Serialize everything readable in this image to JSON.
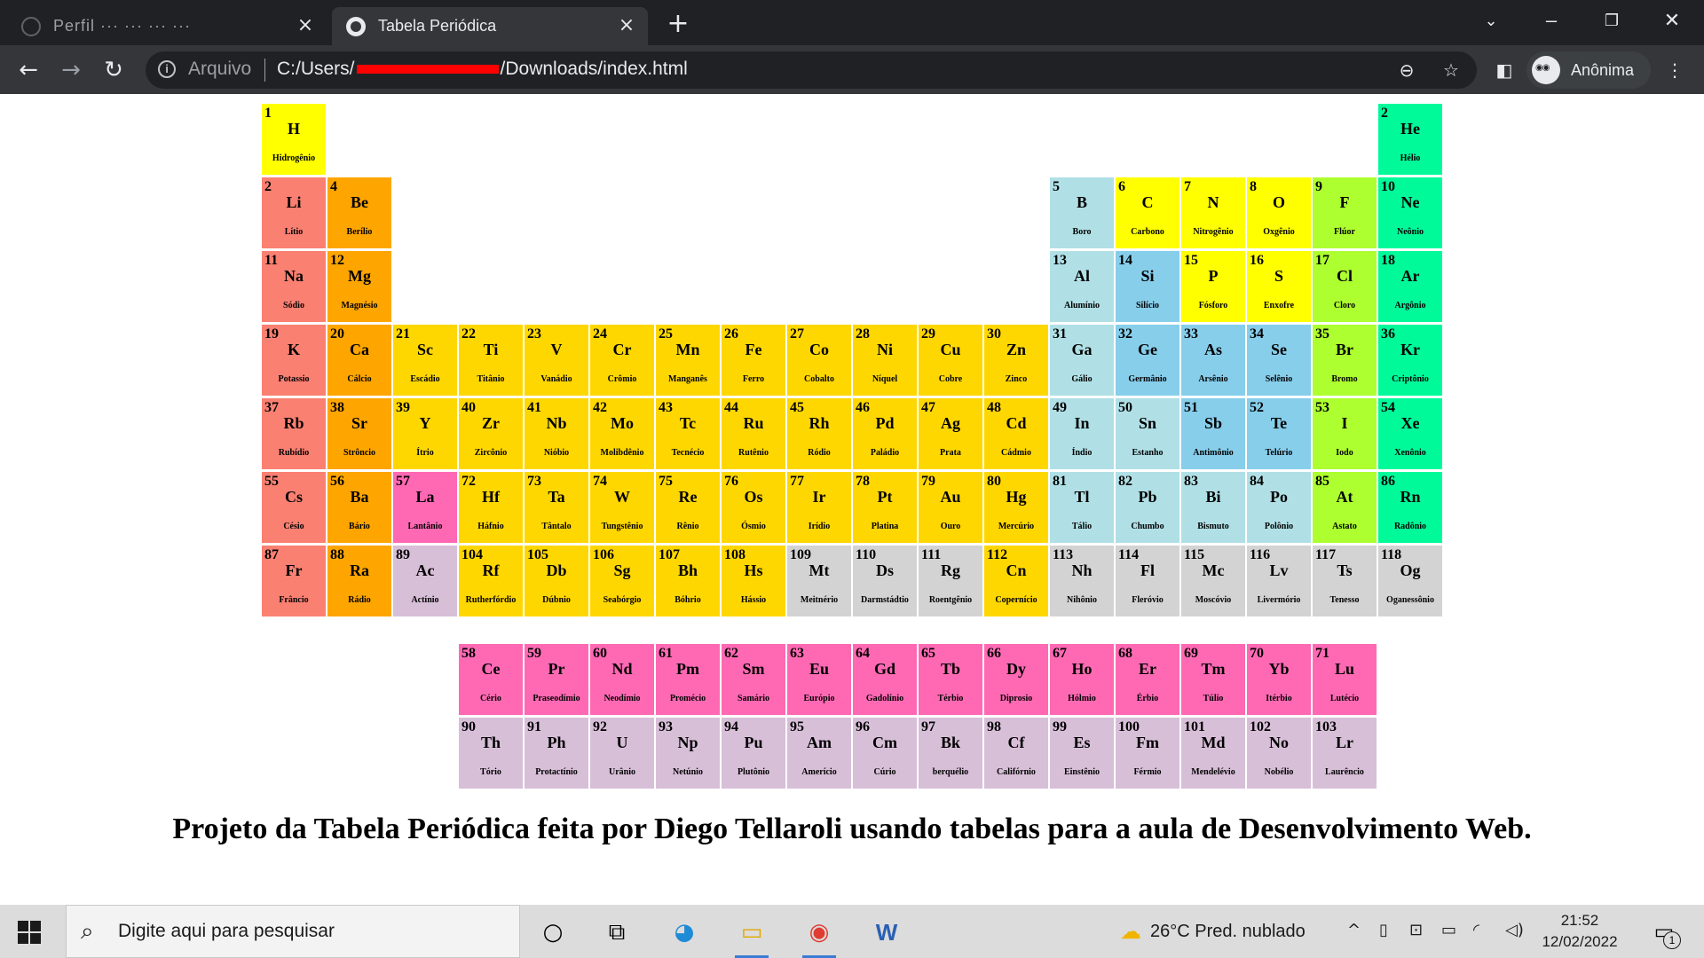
{
  "browser": {
    "inactive_tab_title": "Perfil ··· ··· ··· ···",
    "active_tab_title": "Tabela Periódica",
    "scheme_label": "Arquivo",
    "url_prefix": "C:/Users/",
    "url_suffix": "/Downloads/index.html",
    "profile_name": "Anônima"
  },
  "page": {
    "caption": "Projeto da Tabela Periódica feita por Diego Tellaroli usando tabelas para a aula de Desenvolvimento Web."
  },
  "colors": {
    "hydrogen": "#ffff00",
    "alkali": "#fa8072",
    "alkaline_earth": "#ffa500",
    "transition": "#ffd700",
    "post_transition": "#b0e0e6",
    "metalloid": "#87ceeb",
    "nonmetal": "#ffff00",
    "halogen": "#adff2f",
    "noble_gas": "#00fa9a",
    "lanthanide": "#ff69b4",
    "actinide": "#d8bfd8",
    "unknown": "#d3d3d3"
  },
  "elements": [
    {
      "n": "1",
      "s": "H",
      "name": "Hidrogênio",
      "row": 1,
      "col": 1,
      "cat": "hydrogen"
    },
    {
      "n": "2",
      "s": "He",
      "name": "Hélio",
      "row": 1,
      "col": 18,
      "cat": "noble_gas"
    },
    {
      "n": "2",
      "s": "Li",
      "name": "Lítio",
      "row": 2,
      "col": 1,
      "cat": "alkali"
    },
    {
      "n": "4",
      "s": "Be",
      "name": "Berílio",
      "row": 2,
      "col": 2,
      "cat": "alkaline_earth"
    },
    {
      "n": "5",
      "s": "B",
      "name": "Boro",
      "row": 2,
      "col": 13,
      "cat": "post_transition"
    },
    {
      "n": "6",
      "s": "C",
      "name": "Carbono",
      "row": 2,
      "col": 14,
      "cat": "nonmetal"
    },
    {
      "n": "7",
      "s": "N",
      "name": "Nitrogênio",
      "row": 2,
      "col": 15,
      "cat": "nonmetal"
    },
    {
      "n": "8",
      "s": "O",
      "name": "Oxgênio",
      "row": 2,
      "col": 16,
      "cat": "nonmetal"
    },
    {
      "n": "9",
      "s": "F",
      "name": "Flúor",
      "row": 2,
      "col": 17,
      "cat": "halogen"
    },
    {
      "n": "10",
      "s": "Ne",
      "name": "Neônio",
      "row": 2,
      "col": 18,
      "cat": "noble_gas"
    },
    {
      "n": "11",
      "s": "Na",
      "name": "Sódio",
      "row": 3,
      "col": 1,
      "cat": "alkali"
    },
    {
      "n": "12",
      "s": "Mg",
      "name": "Magnésio",
      "row": 3,
      "col": 2,
      "cat": "alkaline_earth"
    },
    {
      "n": "13",
      "s": "Al",
      "name": "Alumínio",
      "row": 3,
      "col": 13,
      "cat": "post_transition"
    },
    {
      "n": "14",
      "s": "Si",
      "name": "Silício",
      "row": 3,
      "col": 14,
      "cat": "metalloid"
    },
    {
      "n": "15",
      "s": "P",
      "name": "Fósforo",
      "row": 3,
      "col": 15,
      "cat": "nonmetal"
    },
    {
      "n": "16",
      "s": "S",
      "name": "Enxofre",
      "row": 3,
      "col": 16,
      "cat": "nonmetal"
    },
    {
      "n": "17",
      "s": "Cl",
      "name": "Cloro",
      "row": 3,
      "col": 17,
      "cat": "halogen"
    },
    {
      "n": "18",
      "s": "Ar",
      "name": "Argônio",
      "row": 3,
      "col": 18,
      "cat": "noble_gas"
    },
    {
      "n": "19",
      "s": "K",
      "name": "Potassio",
      "row": 4,
      "col": 1,
      "cat": "alkali"
    },
    {
      "n": "20",
      "s": "Ca",
      "name": "Cálcio",
      "row": 4,
      "col": 2,
      "cat": "alkaline_earth"
    },
    {
      "n": "21",
      "s": "Sc",
      "name": "Escádio",
      "row": 4,
      "col": 3,
      "cat": "transition"
    },
    {
      "n": "22",
      "s": "Ti",
      "name": "Titânio",
      "row": 4,
      "col": 4,
      "cat": "transition"
    },
    {
      "n": "23",
      "s": "V",
      "name": "Vanádio",
      "row": 4,
      "col": 5,
      "cat": "transition"
    },
    {
      "n": "24",
      "s": "Cr",
      "name": "Crômio",
      "row": 4,
      "col": 6,
      "cat": "transition"
    },
    {
      "n": "25",
      "s": "Mn",
      "name": "Manganês",
      "row": 4,
      "col": 7,
      "cat": "transition"
    },
    {
      "n": "26",
      "s": "Fe",
      "name": "Ferro",
      "row": 4,
      "col": 8,
      "cat": "transition"
    },
    {
      "n": "27",
      "s": "Co",
      "name": "Cobalto",
      "row": 4,
      "col": 9,
      "cat": "transition"
    },
    {
      "n": "28",
      "s": "Ni",
      "name": "Níquel",
      "row": 4,
      "col": 10,
      "cat": "transition"
    },
    {
      "n": "29",
      "s": "Cu",
      "name": "Cobre",
      "row": 4,
      "col": 11,
      "cat": "transition"
    },
    {
      "n": "30",
      "s": "Zn",
      "name": "Zinco",
      "row": 4,
      "col": 12,
      "cat": "transition"
    },
    {
      "n": "31",
      "s": "Ga",
      "name": "Gálio",
      "row": 4,
      "col": 13,
      "cat": "post_transition"
    },
    {
      "n": "32",
      "s": "Ge",
      "name": "Germânio",
      "row": 4,
      "col": 14,
      "cat": "metalloid"
    },
    {
      "n": "33",
      "s": "As",
      "name": "Arsênio",
      "row": 4,
      "col": 15,
      "cat": "metalloid"
    },
    {
      "n": "34",
      "s": "Se",
      "name": "Selênio",
      "row": 4,
      "col": 16,
      "cat": "metalloid"
    },
    {
      "n": "35",
      "s": "Br",
      "name": "Bromo",
      "row": 4,
      "col": 17,
      "cat": "halogen"
    },
    {
      "n": "36",
      "s": "Kr",
      "name": "Criptônio",
      "row": 4,
      "col": 18,
      "cat": "noble_gas"
    },
    {
      "n": "37",
      "s": "Rb",
      "name": "Rubídio",
      "row": 5,
      "col": 1,
      "cat": "alkali"
    },
    {
      "n": "38",
      "s": "Sr",
      "name": "Strôncio",
      "row": 5,
      "col": 2,
      "cat": "alkaline_earth"
    },
    {
      "n": "39",
      "s": "Y",
      "name": "Ítrio",
      "row": 5,
      "col": 3,
      "cat": "transition"
    },
    {
      "n": "40",
      "s": "Zr",
      "name": "Zircônio",
      "row": 5,
      "col": 4,
      "cat": "transition"
    },
    {
      "n": "41",
      "s": "Nb",
      "name": "Nióbio",
      "row": 5,
      "col": 5,
      "cat": "transition"
    },
    {
      "n": "42",
      "s": "Mo",
      "name": "Molibdênio",
      "row": 5,
      "col": 6,
      "cat": "transition"
    },
    {
      "n": "43",
      "s": "Tc",
      "name": "Tecnécio",
      "row": 5,
      "col": 7,
      "cat": "transition"
    },
    {
      "n": "44",
      "s": "Ru",
      "name": "Rutênio",
      "row": 5,
      "col": 8,
      "cat": "transition"
    },
    {
      "n": "45",
      "s": "Rh",
      "name": "Ródio",
      "row": 5,
      "col": 9,
      "cat": "transition"
    },
    {
      "n": "46",
      "s": "Pd",
      "name": "Paládio",
      "row": 5,
      "col": 10,
      "cat": "transition"
    },
    {
      "n": "47",
      "s": "Ag",
      "name": "Prata",
      "row": 5,
      "col": 11,
      "cat": "transition"
    },
    {
      "n": "48",
      "s": "Cd",
      "name": "Cádmio",
      "row": 5,
      "col": 12,
      "cat": "transition"
    },
    {
      "n": "49",
      "s": "In",
      "name": "Índio",
      "row": 5,
      "col": 13,
      "cat": "post_transition"
    },
    {
      "n": "50",
      "s": "Sn",
      "name": "Estanho",
      "row": 5,
      "col": 14,
      "cat": "post_transition"
    },
    {
      "n": "51",
      "s": "Sb",
      "name": "Antimônio",
      "row": 5,
      "col": 15,
      "cat": "metalloid"
    },
    {
      "n": "52",
      "s": "Te",
      "name": "Telúrio",
      "row": 5,
      "col": 16,
      "cat": "metalloid"
    },
    {
      "n": "53",
      "s": "I",
      "name": "Iodo",
      "row": 5,
      "col": 17,
      "cat": "halogen"
    },
    {
      "n": "54",
      "s": "Xe",
      "name": "Xenônio",
      "row": 5,
      "col": 18,
      "cat": "noble_gas"
    },
    {
      "n": "55",
      "s": "Cs",
      "name": "Césio",
      "row": 6,
      "col": 1,
      "cat": "alkali"
    },
    {
      "n": "56",
      "s": "Ba",
      "name": "Bário",
      "row": 6,
      "col": 2,
      "cat": "alkaline_earth"
    },
    {
      "n": "57",
      "s": "La",
      "name": "Lantânio",
      "row": 6,
      "col": 3,
      "cat": "lanthanide"
    },
    {
      "n": "72",
      "s": "Hf",
      "name": "Háfnio",
      "row": 6,
      "col": 4,
      "cat": "transition"
    },
    {
      "n": "73",
      "s": "Ta",
      "name": "Tântalo",
      "row": 6,
      "col": 5,
      "cat": "transition"
    },
    {
      "n": "74",
      "s": "W",
      "name": "Tungstênio",
      "row": 6,
      "col": 6,
      "cat": "transition"
    },
    {
      "n": "75",
      "s": "Re",
      "name": "Rênio",
      "row": 6,
      "col": 7,
      "cat": "transition"
    },
    {
      "n": "76",
      "s": "Os",
      "name": "Ósmio",
      "row": 6,
      "col": 8,
      "cat": "transition"
    },
    {
      "n": "77",
      "s": "Ir",
      "name": "Irídio",
      "row": 6,
      "col": 9,
      "cat": "transition"
    },
    {
      "n": "78",
      "s": "Pt",
      "name": "Platina",
      "row": 6,
      "col": 10,
      "cat": "transition"
    },
    {
      "n": "79",
      "s": "Au",
      "name": "Ouro",
      "row": 6,
      "col": 11,
      "cat": "transition"
    },
    {
      "n": "80",
      "s": "Hg",
      "name": "Mercúrio",
      "row": 6,
      "col": 12,
      "cat": "transition"
    },
    {
      "n": "81",
      "s": "Tl",
      "name": "Tálio",
      "row": 6,
      "col": 13,
      "cat": "post_transition"
    },
    {
      "n": "82",
      "s": "Pb",
      "name": "Chumbo",
      "row": 6,
      "col": 14,
      "cat": "post_transition"
    },
    {
      "n": "83",
      "s": "Bi",
      "name": "Bismuto",
      "row": 6,
      "col": 15,
      "cat": "post_transition"
    },
    {
      "n": "84",
      "s": "Po",
      "name": "Polônio",
      "row": 6,
      "col": 16,
      "cat": "post_transition"
    },
    {
      "n": "85",
      "s": "At",
      "name": "Astato",
      "row": 6,
      "col": 17,
      "cat": "halogen"
    },
    {
      "n": "86",
      "s": "Rn",
      "name": "Radônio",
      "row": 6,
      "col": 18,
      "cat": "noble_gas"
    },
    {
      "n": "87",
      "s": "Fr",
      "name": "Frâncio",
      "row": 7,
      "col": 1,
      "cat": "alkali"
    },
    {
      "n": "88",
      "s": "Ra",
      "name": "Rádio",
      "row": 7,
      "col": 2,
      "cat": "alkaline_earth"
    },
    {
      "n": "89",
      "s": "Ac",
      "name": "Actínio",
      "row": 7,
      "col": 3,
      "cat": "actinide"
    },
    {
      "n": "104",
      "s": "Rf",
      "name": "Rutherfórdio",
      "row": 7,
      "col": 4,
      "cat": "transition"
    },
    {
      "n": "105",
      "s": "Db",
      "name": "Dúbnio",
      "row": 7,
      "col": 5,
      "cat": "transition"
    },
    {
      "n": "106",
      "s": "Sg",
      "name": "Seabórgio",
      "row": 7,
      "col": 6,
      "cat": "transition"
    },
    {
      "n": "107",
      "s": "Bh",
      "name": "Bóhrio",
      "row": 7,
      "col": 7,
      "cat": "transition"
    },
    {
      "n": "108",
      "s": "Hs",
      "name": "Hássio",
      "row": 7,
      "col": 8,
      "cat": "transition"
    },
    {
      "n": "109",
      "s": "Mt",
      "name": "Meitnério",
      "row": 7,
      "col": 9,
      "cat": "unknown"
    },
    {
      "n": "110",
      "s": "Ds",
      "name": "Darmstádtio",
      "row": 7,
      "col": 10,
      "cat": "unknown"
    },
    {
      "n": "111",
      "s": "Rg",
      "name": "Roentgênio",
      "row": 7,
      "col": 11,
      "cat": "unknown"
    },
    {
      "n": "112",
      "s": "Cn",
      "name": "Copernício",
      "row": 7,
      "col": 12,
      "cat": "transition"
    },
    {
      "n": "113",
      "s": "Nh",
      "name": "Nihônio",
      "row": 7,
      "col": 13,
      "cat": "unknown"
    },
    {
      "n": "114",
      "s": "Fl",
      "name": "Fleróvio",
      "row": 7,
      "col": 14,
      "cat": "unknown"
    },
    {
      "n": "115",
      "s": "Mc",
      "name": "Moscóvio",
      "row": 7,
      "col": 15,
      "cat": "unknown"
    },
    {
      "n": "116",
      "s": "Lv",
      "name": "Livermório",
      "row": 7,
      "col": 16,
      "cat": "unknown"
    },
    {
      "n": "117",
      "s": "Ts",
      "name": "Tenesso",
      "row": 7,
      "col": 17,
      "cat": "unknown"
    },
    {
      "n": "118",
      "s": "Og",
      "name": "Oganessônio",
      "row": 7,
      "col": 18,
      "cat": "unknown"
    },
    {
      "n": "58",
      "s": "Ce",
      "name": "Cério",
      "row": 9,
      "col": 4,
      "cat": "lanthanide"
    },
    {
      "n": "59",
      "s": "Pr",
      "name": "Praseodímio",
      "row": 9,
      "col": 5,
      "cat": "lanthanide"
    },
    {
      "n": "60",
      "s": "Nd",
      "name": "Neodímio",
      "row": 9,
      "col": 6,
      "cat": "lanthanide"
    },
    {
      "n": "61",
      "s": "Pm",
      "name": "Promécio",
      "row": 9,
      "col": 7,
      "cat": "lanthanide"
    },
    {
      "n": "62",
      "s": "Sm",
      "name": "Samário",
      "row": 9,
      "col": 8,
      "cat": "lanthanide"
    },
    {
      "n": "63",
      "s": "Eu",
      "name": "Európio",
      "row": 9,
      "col": 9,
      "cat": "lanthanide"
    },
    {
      "n": "64",
      "s": "Gd",
      "name": "Gadolínio",
      "row": 9,
      "col": 10,
      "cat": "lanthanide"
    },
    {
      "n": "65",
      "s": "Tb",
      "name": "Térbio",
      "row": 9,
      "col": 11,
      "cat": "lanthanide"
    },
    {
      "n": "66",
      "s": "Dy",
      "name": "Diprosio",
      "row": 9,
      "col": 12,
      "cat": "lanthanide"
    },
    {
      "n": "67",
      "s": "Ho",
      "name": "Hólmio",
      "row": 9,
      "col": 13,
      "cat": "lanthanide"
    },
    {
      "n": "68",
      "s": "Er",
      "name": "Érbio",
      "row": 9,
      "col": 14,
      "cat": "lanthanide"
    },
    {
      "n": "69",
      "s": "Tm",
      "name": "Túlio",
      "row": 9,
      "col": 15,
      "cat": "lanthanide"
    },
    {
      "n": "70",
      "s": "Yb",
      "name": "Itérbio",
      "row": 9,
      "col": 16,
      "cat": "lanthanide"
    },
    {
      "n": "71",
      "s": "Lu",
      "name": "Lutécio",
      "row": 9,
      "col": 17,
      "cat": "lanthanide"
    },
    {
      "n": "90",
      "s": "Th",
      "name": "Tório",
      "row": 10,
      "col": 4,
      "cat": "actinide"
    },
    {
      "n": "91",
      "s": "Ph",
      "name": "Protactínio",
      "row": 10,
      "col": 5,
      "cat": "actinide"
    },
    {
      "n": "92",
      "s": "U",
      "name": "Urânio",
      "row": 10,
      "col": 6,
      "cat": "actinide"
    },
    {
      "n": "93",
      "s": "Np",
      "name": "Netúnio",
      "row": 10,
      "col": 7,
      "cat": "actinide"
    },
    {
      "n": "94",
      "s": "Pu",
      "name": "Plutônio",
      "row": 10,
      "col": 8,
      "cat": "actinide"
    },
    {
      "n": "95",
      "s": "Am",
      "name": "Amerício",
      "row": 10,
      "col": 9,
      "cat": "actinide"
    },
    {
      "n": "96",
      "s": "Cm",
      "name": "Cúrio",
      "row": 10,
      "col": 10,
      "cat": "actinide"
    },
    {
      "n": "97",
      "s": "Bk",
      "name": "berquélio",
      "row": 10,
      "col": 11,
      "cat": "actinide"
    },
    {
      "n": "98",
      "s": "Cf",
      "name": "Califórnio",
      "row": 10,
      "col": 12,
      "cat": "actinide"
    },
    {
      "n": "99",
      "s": "Es",
      "name": "Einstênio",
      "row": 10,
      "col": 13,
      "cat": "actinide"
    },
    {
      "n": "100",
      "s": "Fm",
      "name": "Férmio",
      "row": 10,
      "col": 14,
      "cat": "actinide"
    },
    {
      "n": "101",
      "s": "Md",
      "name": "Mendelévio",
      "row": 10,
      "col": 15,
      "cat": "actinide"
    },
    {
      "n": "102",
      "s": "No",
      "name": "Nobélio",
      "row": 10,
      "col": 16,
      "cat": "actinide"
    },
    {
      "n": "103",
      "s": "Lr",
      "name": "Laurêncio",
      "row": 10,
      "col": 17,
      "cat": "actinide"
    }
  ],
  "taskbar": {
    "search_placeholder": "Digite aqui para pesquisar",
    "weather": "26°C  Pred. nublado",
    "time": "21:52",
    "date": "12/02/2022",
    "notification_count": "1"
  }
}
